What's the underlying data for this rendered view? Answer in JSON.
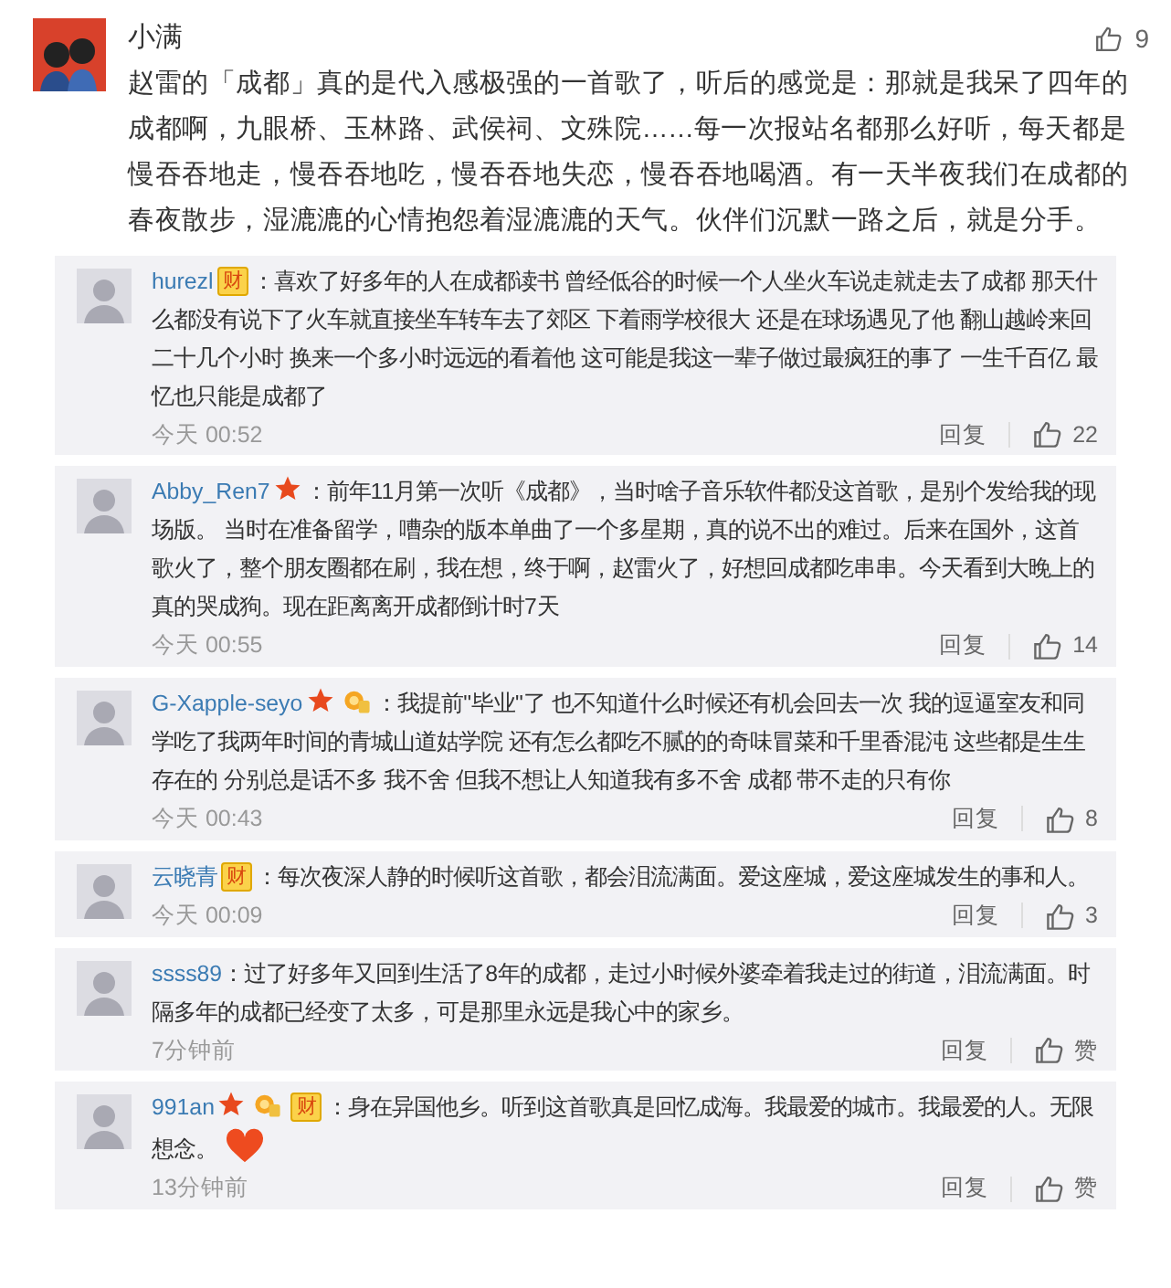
{
  "post": {
    "author": "小满",
    "likes": "9",
    "text": "赵雷的「成都」真的是代入感极强的一首歌了，听后的感觉是：那就是我呆了四年的成都啊，九眼桥、玉林路、武侯祠、文殊院……每一次报站名都那么好听，每天都是慢吞吞地走，慢吞吞地吃，慢吞吞地失恋，慢吞吞地喝酒。有一天半夜我们在成都的春夜散步，湿漉漉的心情抱怨着湿漉漉的天气。伙伴们沉默一路之后，就是分手。"
  },
  "comments": [
    {
      "author": "hurezl",
      "badges": [
        {
          "kind": "wealth",
          "text": "财"
        }
      ],
      "text": "：喜欢了好多年的人在成都读书 曾经低谷的时候一个人坐火车说走就走去了成都 那天什么都没有说下了火车就直接坐车转车去了郊区 下着雨学校很大 还是在球场遇见了他 翻山越岭来回二十几个小时 换来一个多小时远远的看着他 这可能是我这一辈子做过最疯狂的事了 一生千百亿 最忆也只能是成都了",
      "heart": false,
      "time": "今天 00:52",
      "reply": "回复",
      "likes": "22"
    },
    {
      "author": "Abby_Ren7",
      "badges": [
        {
          "kind": "star"
        }
      ],
      "text": "：前年11月第一次听《成都》，当时啥子音乐软件都没这首歌，是别个发给我的现场版。 当时在准备留学，嘈杂的版本单曲了一个多星期，真的说不出的难过。后来在国外，这首歌火了，整个朋友圈都在刷，我在想，终于啊，赵雷火了，好想回成都吃串串。今天看到大晚上的真的哭成狗。现在距离离开成都倒计时7天",
      "heart": false,
      "time": "今天 00:55",
      "reply": "回复",
      "likes": "14"
    },
    {
      "author": "G-Xapple-seyo",
      "badges": [
        {
          "kind": "star"
        },
        {
          "kind": "medal"
        }
      ],
      "text": "：我提前\"毕业\"了 也不知道什么时候还有机会回去一次 我的逗逼室友和同学吃了我两年时间的青城山道姑学院 还有怎么都吃不腻的的奇味冒菜和千里香混沌 这些都是生生存在的 分别总是话不多 我不舍 但我不想让人知道我有多不舍 成都 带不走的只有你",
      "heart": false,
      "time": "今天 00:43",
      "reply": "回复",
      "likes": "8"
    },
    {
      "author": "云晓青",
      "badges": [
        {
          "kind": "wealth",
          "text": "财"
        }
      ],
      "text": "：每次夜深人静的时候听这首歌，都会泪流满面。爱这座城，爱这座城发生的事和人。",
      "heart": false,
      "time": "今天 00:09",
      "reply": "回复",
      "likes": "3"
    },
    {
      "author": "ssss89",
      "text": "：过了好多年又回到生活了8年的成都，走过小时候外婆牵着我走过的街道，泪流满面。时隔多年的成都已经变了太多，可是那里永远是我心中的家乡。",
      "heart": false,
      "time": "7分钟前",
      "reply": "回复",
      "likes": "赞"
    },
    {
      "author": "991an",
      "badges": [
        {
          "kind": "star"
        },
        {
          "kind": "medal"
        },
        {
          "kind": "wealth",
          "text": "财"
        }
      ],
      "text": "：身在异国他乡。听到这首歌真是回忆成海。我最爱的城市。我最爱的人。无限想念。",
      "heart": true,
      "time": "13分钟前",
      "reply": "回复",
      "likes": "赞"
    }
  ]
}
